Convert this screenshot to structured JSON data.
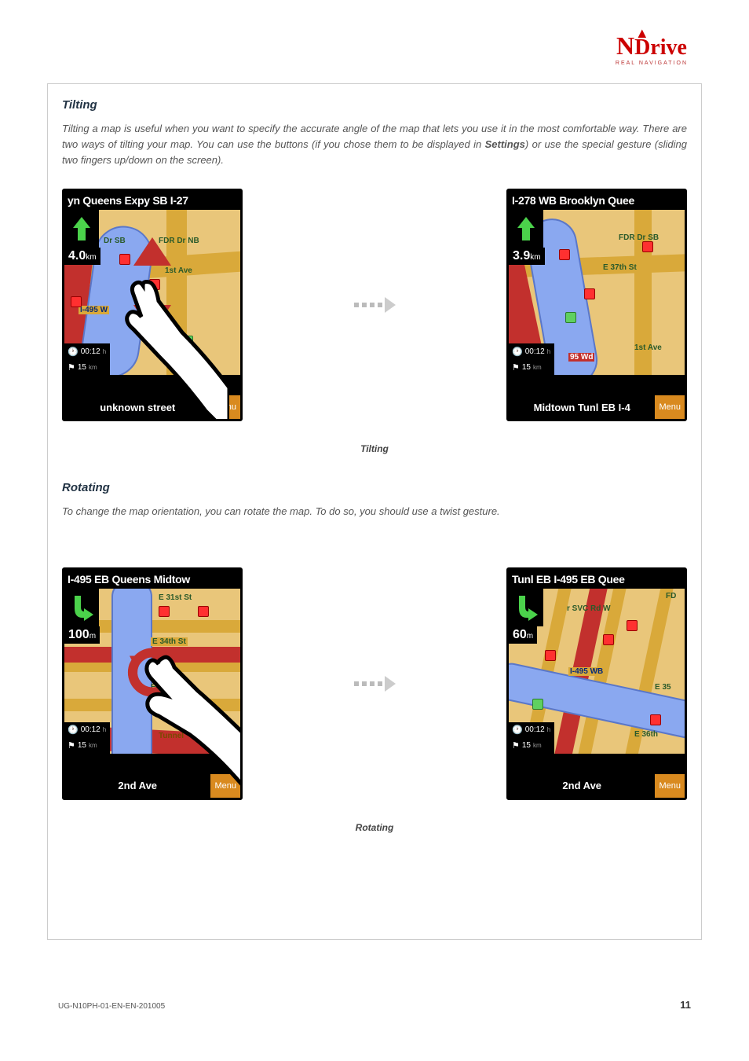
{
  "logo": {
    "brand_n": "N",
    "brand_rest": "Drive",
    "tag": "REAL NAVIGATION"
  },
  "tilting": {
    "heading": "Tilting",
    "para_a": "Tilting a map is useful when you want to specify the accurate angle of the map that lets you use it in the most comfortable way. There are two ways of tilting your map. You can use the buttons (if you chose them to be displayed in ",
    "para_bold": "Settings",
    "para_b": ") or use the special gesture (sliding two fingers up/down on the screen).",
    "caption": "Tilting",
    "left": {
      "top": "yn Queens Expy SB   I-27",
      "dist": "4.0",
      "dist_u": "km",
      "time": "00:12",
      "time_u": "h",
      "rem": "15",
      "rem_u": "km",
      "bottom": "unknown street",
      "menu": "Menu",
      "r1": "Dr SB",
      "r2": "FDR Dr NB",
      "r3": "1st Ave",
      "r4": "I-495 W"
    },
    "right": {
      "top": "I-278 WB   Brooklyn Quee",
      "dist": "3.9",
      "dist_u": "km",
      "time": "00:12",
      "time_u": "h",
      "rem": "15",
      "rem_u": "km",
      "bottom": "Midtown Tunl EB   I-4",
      "menu": "Menu",
      "r1": "FDR Dr SB",
      "r2": "E 37th St",
      "r3": "1st Ave",
      "r4": "95 Wd"
    }
  },
  "rotating": {
    "heading": "Rotating",
    "para": "To change the map orientation, you can rotate the map. To do so, you should use a twist gesture.",
    "caption": "Rotating",
    "left": {
      "top": "I-495 EB   Queens Midtow",
      "dist": "100",
      "dist_u": "m",
      "time": "00:12",
      "time_u": "h",
      "rem": "15",
      "rem_u": "km",
      "bottom": "2nd Ave",
      "menu": "Menu",
      "r1": "E 31st St",
      "r2": "E 34th St",
      "r3": "E 36th St",
      "r4": "Tunnel"
    },
    "right": {
      "top": "Tunl EB   I-495 EB   Quee",
      "dist": "60",
      "dist_u": "m",
      "time": "00:12",
      "time_u": "h",
      "rem": "15",
      "rem_u": "km",
      "bottom": "2nd Ave",
      "menu": "Menu",
      "r1": "r SVC Rd W",
      "r2": "I-495 WB",
      "r3": "E 36th",
      "r4": "E 35",
      "r5": "FD"
    }
  },
  "footer": {
    "doc": "UG-N10PH-01-EN-EN-201005",
    "page": "11"
  }
}
